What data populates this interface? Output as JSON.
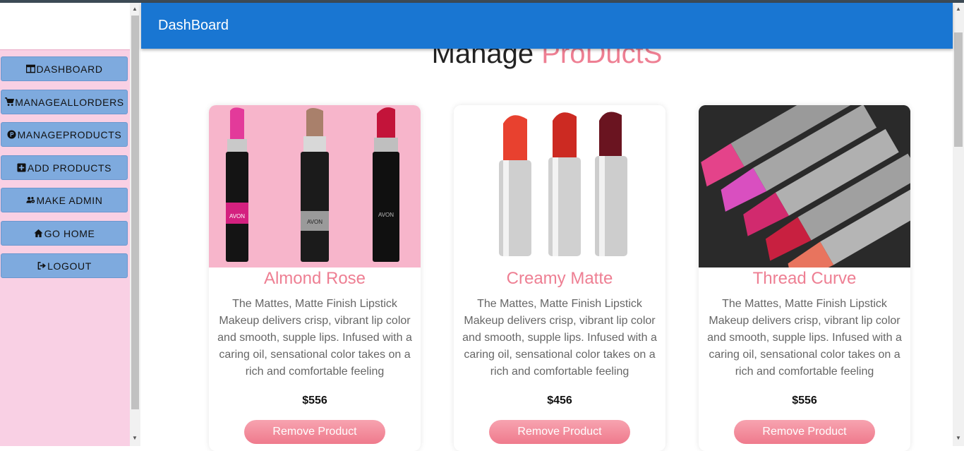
{
  "header": {
    "title": "DashBoard"
  },
  "page": {
    "heading_main": "Manage",
    "heading_accent": "ProDuctS"
  },
  "sidebar": {
    "items": [
      {
        "label": "DASHBOARD",
        "icon": "columns-icon"
      },
      {
        "label": "MANAGEALLORDERS",
        "icon": "cart-icon"
      },
      {
        "label": "MANAGEPRODUCTS",
        "icon": "product-hunt-icon"
      },
      {
        "label": "ADD PRODUCTS",
        "icon": "plus-square-icon"
      },
      {
        "label": "MAKE ADMIN",
        "icon": "users-cog-icon"
      },
      {
        "label": "GO HOME",
        "icon": "home-icon"
      },
      {
        "label": "LOGOUT",
        "icon": "sign-out-icon"
      }
    ]
  },
  "products": [
    {
      "name": "Almond Rose",
      "description": "The Mattes, Matte Finish Lipstick Makeup delivers crisp, vibrant lip color and smooth, supple lips. Infused with a caring oil, sensational color takes on a rich and comfortable feeling",
      "price": "$556",
      "button": "Remove Product"
    },
    {
      "name": "Creamy Matte",
      "description": "The Mattes, Matte Finish Lipstick Makeup delivers crisp, vibrant lip color and smooth, supple lips. Infused with a caring oil, sensational color takes on a rich and comfortable feeling",
      "price": "$456",
      "button": "Remove Product"
    },
    {
      "name": "Thread Curve",
      "description": "The Mattes, Matte Finish Lipstick Makeup delivers crisp, vibrant lip color and smooth, supple lips. Infused with a caring oil, sensational color takes on a rich and comfortable feeling",
      "price": "$556",
      "button": "Remove Product"
    }
  ],
  "image_labels": {
    "brand": "AVON"
  },
  "colors": {
    "appbar": "#1976d2",
    "accent": "#ee7f93",
    "sidebar_bg": "#f9d0e4",
    "nav_button": "#7eaade"
  }
}
